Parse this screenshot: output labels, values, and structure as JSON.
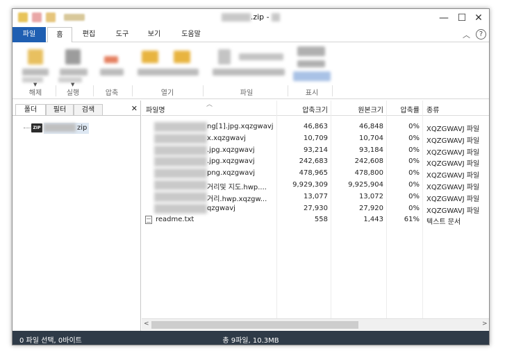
{
  "window": {
    "title_suffix": ".zip - ",
    "controls": {
      "minimize": "—",
      "maximize": "☐",
      "close": "✕"
    }
  },
  "menu": {
    "tabs": [
      "파일",
      "홈",
      "편집",
      "도구",
      "보기",
      "도움말"
    ],
    "active_tab": "홈",
    "help_symbol": "?",
    "collapse_symbol": "︿"
  },
  "ribbon": {
    "groups": [
      "해제",
      "실행",
      "압축",
      "열기",
      "파일",
      "표시"
    ]
  },
  "left_pane": {
    "tabs": [
      "폴더",
      "필터",
      "검색"
    ],
    "close_symbol": "✕",
    "tree_item_suffix": "zip",
    "zip_badge": "ZIP"
  },
  "file_list": {
    "columns": [
      "파일명",
      "압축크기",
      "원본크기",
      "압축률",
      "종류"
    ],
    "rows": [
      {
        "name": "ng[1].jpg.xqzgwavj",
        "packed": "46,863",
        "original": "46,848",
        "ratio": "0%",
        "type": "XQZGWAVJ 파일",
        "icon": "blurred"
      },
      {
        "name": "x.xqzgwavj",
        "packed": "10,709",
        "original": "10,704",
        "ratio": "0%",
        "type": "XQZGWAVJ 파일",
        "icon": "blurred"
      },
      {
        "name": ".jpg.xqzgwavj",
        "packed": "93,214",
        "original": "93,184",
        "ratio": "0%",
        "type": "XQZGWAVJ 파일",
        "icon": "blurred"
      },
      {
        "name": ".jpg.xqzgwavj",
        "packed": "242,683",
        "original": "242,608",
        "ratio": "0%",
        "type": "XQZGWAVJ 파일",
        "icon": "blurred"
      },
      {
        "name": "png.xqzgwavj",
        "packed": "478,965",
        "original": "478,800",
        "ratio": "0%",
        "type": "XQZGWAVJ 파일",
        "icon": "blurred"
      },
      {
        "name": "거리및 지도.hwp....",
        "packed": "9,929,309",
        "original": "9,925,904",
        "ratio": "0%",
        "type": "XQZGWAVJ 파일",
        "icon": "blurred"
      },
      {
        "name": "거리.hwp.xqzgw...",
        "packed": "13,077",
        "original": "13,072",
        "ratio": "0%",
        "type": "XQZGWAVJ 파일",
        "icon": "blurred"
      },
      {
        "name": "qzgwavj",
        "packed": "27,930",
        "original": "27,920",
        "ratio": "0%",
        "type": "XQZGWAVJ 파일",
        "icon": "blurred"
      },
      {
        "name": "readme.txt",
        "packed": "558",
        "original": "1,443",
        "ratio": "61%",
        "type": "텍스트 문서",
        "icon": "text-document"
      }
    ]
  },
  "status": {
    "left": "0 파일 선택, 0바이트",
    "center": "총 9파일, 10.3MB"
  },
  "colors": {
    "file_tab": "#1f5fb2",
    "status_bar": "#2f3b48",
    "tree_selection": "#dde7f2"
  }
}
